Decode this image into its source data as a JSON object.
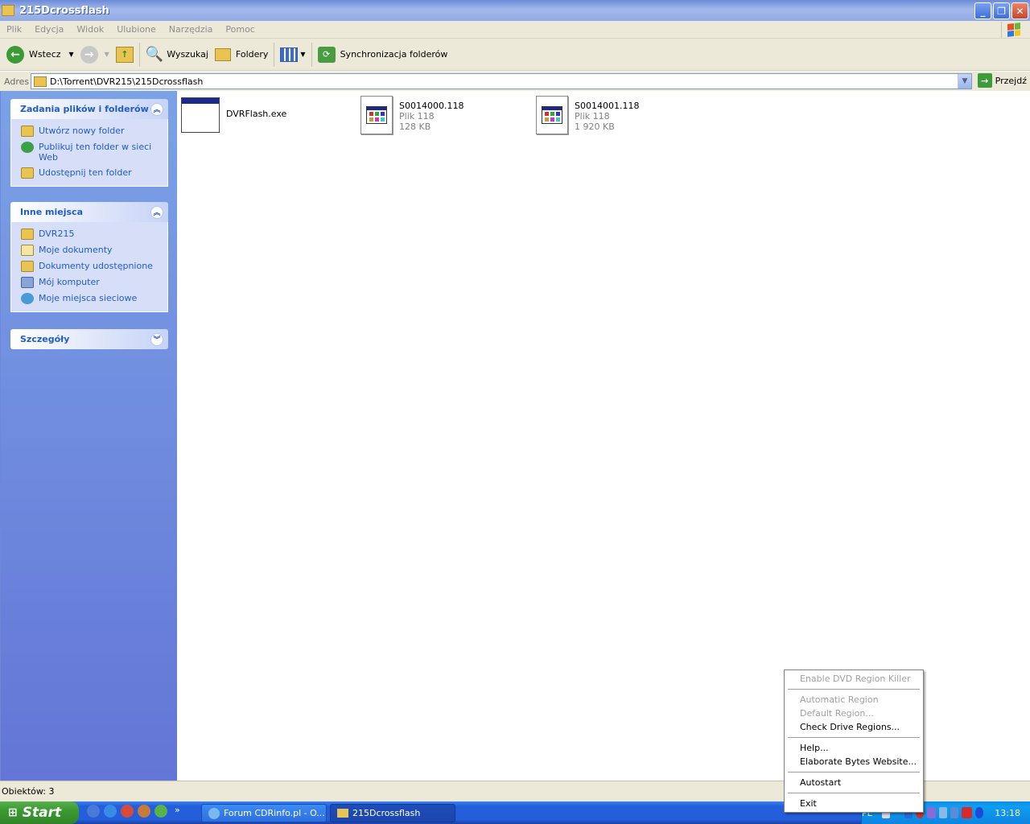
{
  "window": {
    "title": "215Dcrossflash"
  },
  "menu": [
    "Plik",
    "Edycja",
    "Widok",
    "Ulubione",
    "Narzędzia",
    "Pomoc"
  ],
  "toolbar": {
    "back": "Wstecz",
    "search": "Wyszukaj",
    "folders": "Foldery",
    "sync": "Synchronizacja folderów"
  },
  "address": {
    "label": "Adres",
    "value": "D:\\Torrent\\DVR215\\215Dcrossflash",
    "go": "Przejdź"
  },
  "tasks": {
    "title": "Zadania plików i folderów",
    "items": [
      "Utwórz nowy folder",
      "Publikuj ten folder w sieci Web",
      "Udostępnij ten folder"
    ]
  },
  "places": {
    "title": "Inne miejsca",
    "items": [
      "DVR215",
      "Moje dokumenty",
      "Dokumenty udostępnione",
      "Mój komputer",
      "Moje miejsca sieciowe"
    ]
  },
  "details": {
    "title": "Szczegóły"
  },
  "files": [
    {
      "name": "DVRFlash.exe",
      "type": "",
      "size": ""
    },
    {
      "name": "S0014000.118",
      "type": "Plik 118",
      "size": "128 KB"
    },
    {
      "name": "S0014001.118",
      "type": "Plik 118",
      "size": "1 920 KB"
    }
  ],
  "status": {
    "text": "Obiektów: 3"
  },
  "taskbar": {
    "start": "Start",
    "buttons": [
      "Forum CDRinfo.pl - O...",
      "215Dcrossflash"
    ],
    "clock": "13:18",
    "lang": "PL"
  },
  "context_menu": {
    "items": [
      {
        "label": "Enable DVD Region Killer",
        "disabled": true
      },
      {
        "label": "Automatic Region",
        "disabled": true
      },
      {
        "label": "Default Region...",
        "disabled": true
      },
      {
        "label": "Check Drive Regions...",
        "disabled": false
      },
      {
        "label": "Help...",
        "disabled": false
      },
      {
        "label": "Elaborate Bytes Website...",
        "disabled": false
      },
      {
        "label": "Autostart",
        "disabled": false
      },
      {
        "label": "Exit",
        "disabled": false
      }
    ]
  },
  "colors": {
    "title_bar": "#6b8ad8",
    "link": "#215dc6",
    "taskbar": "#245edb",
    "start": "#3c9a32"
  }
}
